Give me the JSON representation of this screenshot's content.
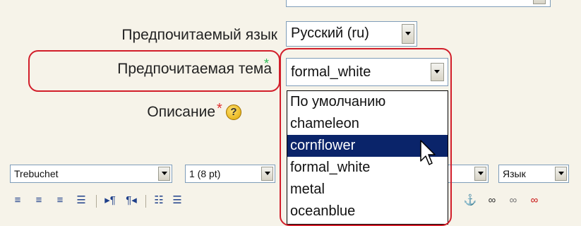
{
  "form": {
    "language_label": "Предпочитаемый язык",
    "language_value": "Русский (ru)",
    "theme_label": "Предпочитаемая тема",
    "theme_required_mark": "*",
    "theme_value": "formal_white",
    "description_label": "Описание",
    "description_required_mark": "*",
    "help_icon_text": "?"
  },
  "theme_dropdown": {
    "options": [
      "По умолчанию",
      "chameleon",
      "cornflower",
      "formal_white",
      "metal",
      "oceanblue"
    ],
    "highlighted": "cornflower"
  },
  "editor_toolbar": {
    "font_value": "Trebuchet",
    "size_value": "1 (8 pt)",
    "language_value": "Язык",
    "icons": [
      "align-left-icon",
      "align-center-icon",
      "align-right-icon",
      "align-justify-icon",
      "ltr-icon",
      "rtl-icon",
      "ordered-list-icon",
      "unordered-list-icon",
      "anchor-icon",
      "link-icon",
      "unlink-icon",
      "nolink-icon"
    ]
  },
  "colors": {
    "highlight_border": "#d21e2a",
    "selection_bg": "#0a246a",
    "required_green": "#2dbb55",
    "required_red": "#e03030"
  }
}
